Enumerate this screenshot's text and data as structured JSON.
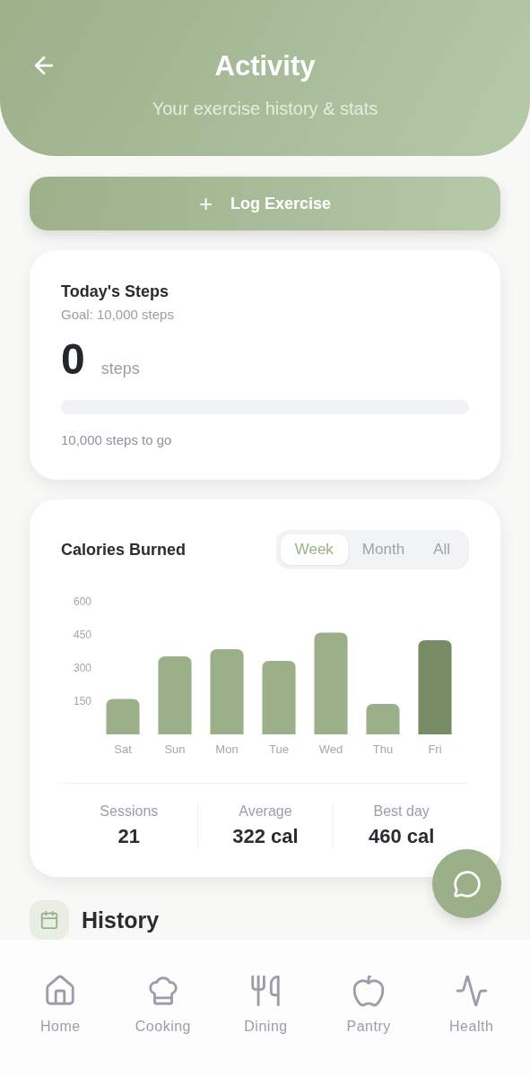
{
  "header": {
    "title": "Activity",
    "subtitle": "Your exercise history & stats"
  },
  "log_button": {
    "icon": "+",
    "label": "Log Exercise"
  },
  "steps_card": {
    "title": "Today's Steps",
    "goal": "Goal: 10,000 steps",
    "count": "0",
    "unit": "steps",
    "level": 0,
    "remaining": "10,000 steps to go"
  },
  "calories_card": {
    "title": "Calories Burned",
    "tabs": [
      {
        "label": "Week",
        "selected": true
      },
      {
        "label": "Month",
        "selected": false
      },
      {
        "label": "All",
        "selected": false
      }
    ],
    "chart_data": {
      "type": "bar",
      "categories": [
        "Sat",
        "Sun",
        "Mon",
        "Tue",
        "Wed",
        "Thu",
        "Fri"
      ],
      "series": [
        {
          "color": "#9bb088",
          "values": [
            160,
            353,
            385,
            332,
            460,
            138,
            null
          ]
        },
        {
          "color": "#778c64",
          "values": [
            null,
            null,
            null,
            null,
            null,
            null,
            426
          ]
        }
      ],
      "ylim": [
        0,
        600
      ],
      "yticks": [
        150,
        300,
        450,
        600
      ]
    },
    "stats": [
      {
        "label": "Sessions",
        "value": "21"
      },
      {
        "label": "Average",
        "value": "322 cal"
      },
      {
        "label": "Best day",
        "value": "460 cal"
      }
    ]
  },
  "history": {
    "title": "History"
  },
  "nav": [
    {
      "label": "Home",
      "selected": false
    },
    {
      "label": "Cooking",
      "selected": false
    },
    {
      "label": "Dining",
      "selected": false
    },
    {
      "label": "Pantry",
      "selected": false
    },
    {
      "label": "Health",
      "selected": false
    }
  ]
}
